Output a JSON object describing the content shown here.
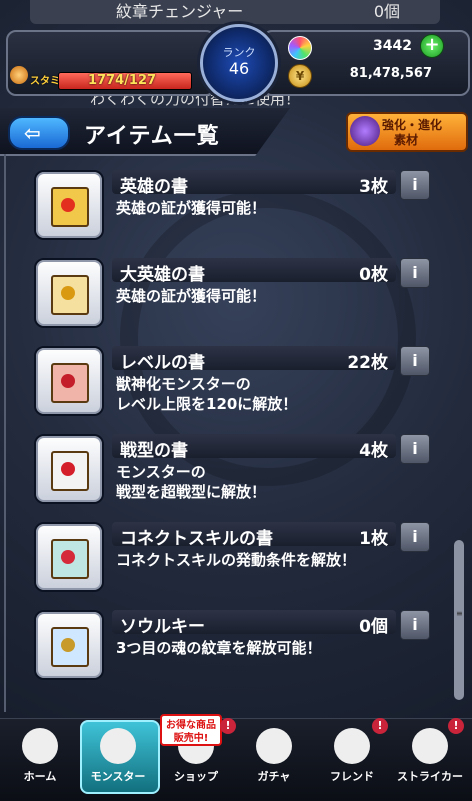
{
  "header": {
    "partial_row_title": "紋章チェンジャー",
    "partial_row_count": "0個",
    "partial_row2_desc": "わくわくの力の付替えに使用！",
    "stamina_label": "スタミナ",
    "stamina_value": "1774/127",
    "stamina_fraction": 1.0,
    "rank_label": "ランク",
    "rank_value": "46",
    "orb_count": "3442",
    "gold_count": "81,478,567"
  },
  "titlebar": {
    "back_arrow": "⇦",
    "title": "アイテム一覧",
    "evo_line1": "強化・進化",
    "evo_line2": "素材"
  },
  "items": [
    {
      "name": "英雄の書",
      "count": "3枚",
      "desc1": "英雄の証が獲得可能！",
      "desc2": "",
      "icon": "hero-book-icon",
      "color": "#f2c84b",
      "emblem": "#e3301e"
    },
    {
      "name": "大英雄の書",
      "count": "0枚",
      "desc1": "英雄の証が獲得可能！",
      "desc2": "",
      "icon": "great-hero-book-icon",
      "color": "#f5e0a0",
      "emblem": "#d99a12"
    },
    {
      "name": "レベルの書",
      "count": "22枚",
      "desc1": "獣神化モンスターの",
      "desc2": "レベル上限を120に解放！",
      "icon": "level-book-icon",
      "color": "#f0b4a8",
      "emblem": "#c41e2a"
    },
    {
      "name": "戦型の書",
      "count": "4枚",
      "desc1": "モンスターの",
      "desc2": "戦型を超戦型に解放！",
      "icon": "battle-type-book-icon",
      "color": "#f3f3f3",
      "emblem": "#d41e2a"
    },
    {
      "name": "コネクトスキルの書",
      "count": "1枚",
      "desc1": "コネクトスキルの発動条件を解放！",
      "desc2": "",
      "icon": "connect-skill-book-icon",
      "color": "#bfe6e2",
      "emblem": "#d42a3a"
    },
    {
      "name": "ソウルキー",
      "count": "0個",
      "desc1": "3つ目の魂の紋章を解放可能！",
      "desc2": "",
      "icon": "soul-key-icon",
      "color": "#cfe8ff",
      "emblem": "#c79a2a"
    }
  ],
  "info_label": "i",
  "nav": [
    {
      "label": "ホーム",
      "icon": "home-icon"
    },
    {
      "label": "モンスター",
      "icon": "monster-icon"
    },
    {
      "label": "ショップ",
      "icon": "shop-icon"
    },
    {
      "label": "ガチャ",
      "icon": "gacha-icon"
    },
    {
      "label": "フレンド",
      "icon": "friend-icon"
    },
    {
      "label": "ストライカー",
      "icon": "striker-icon"
    }
  ],
  "sale_badge": {
    "line1": "お得な商品",
    "line2": "販売中!"
  },
  "alert_mark": "!"
}
